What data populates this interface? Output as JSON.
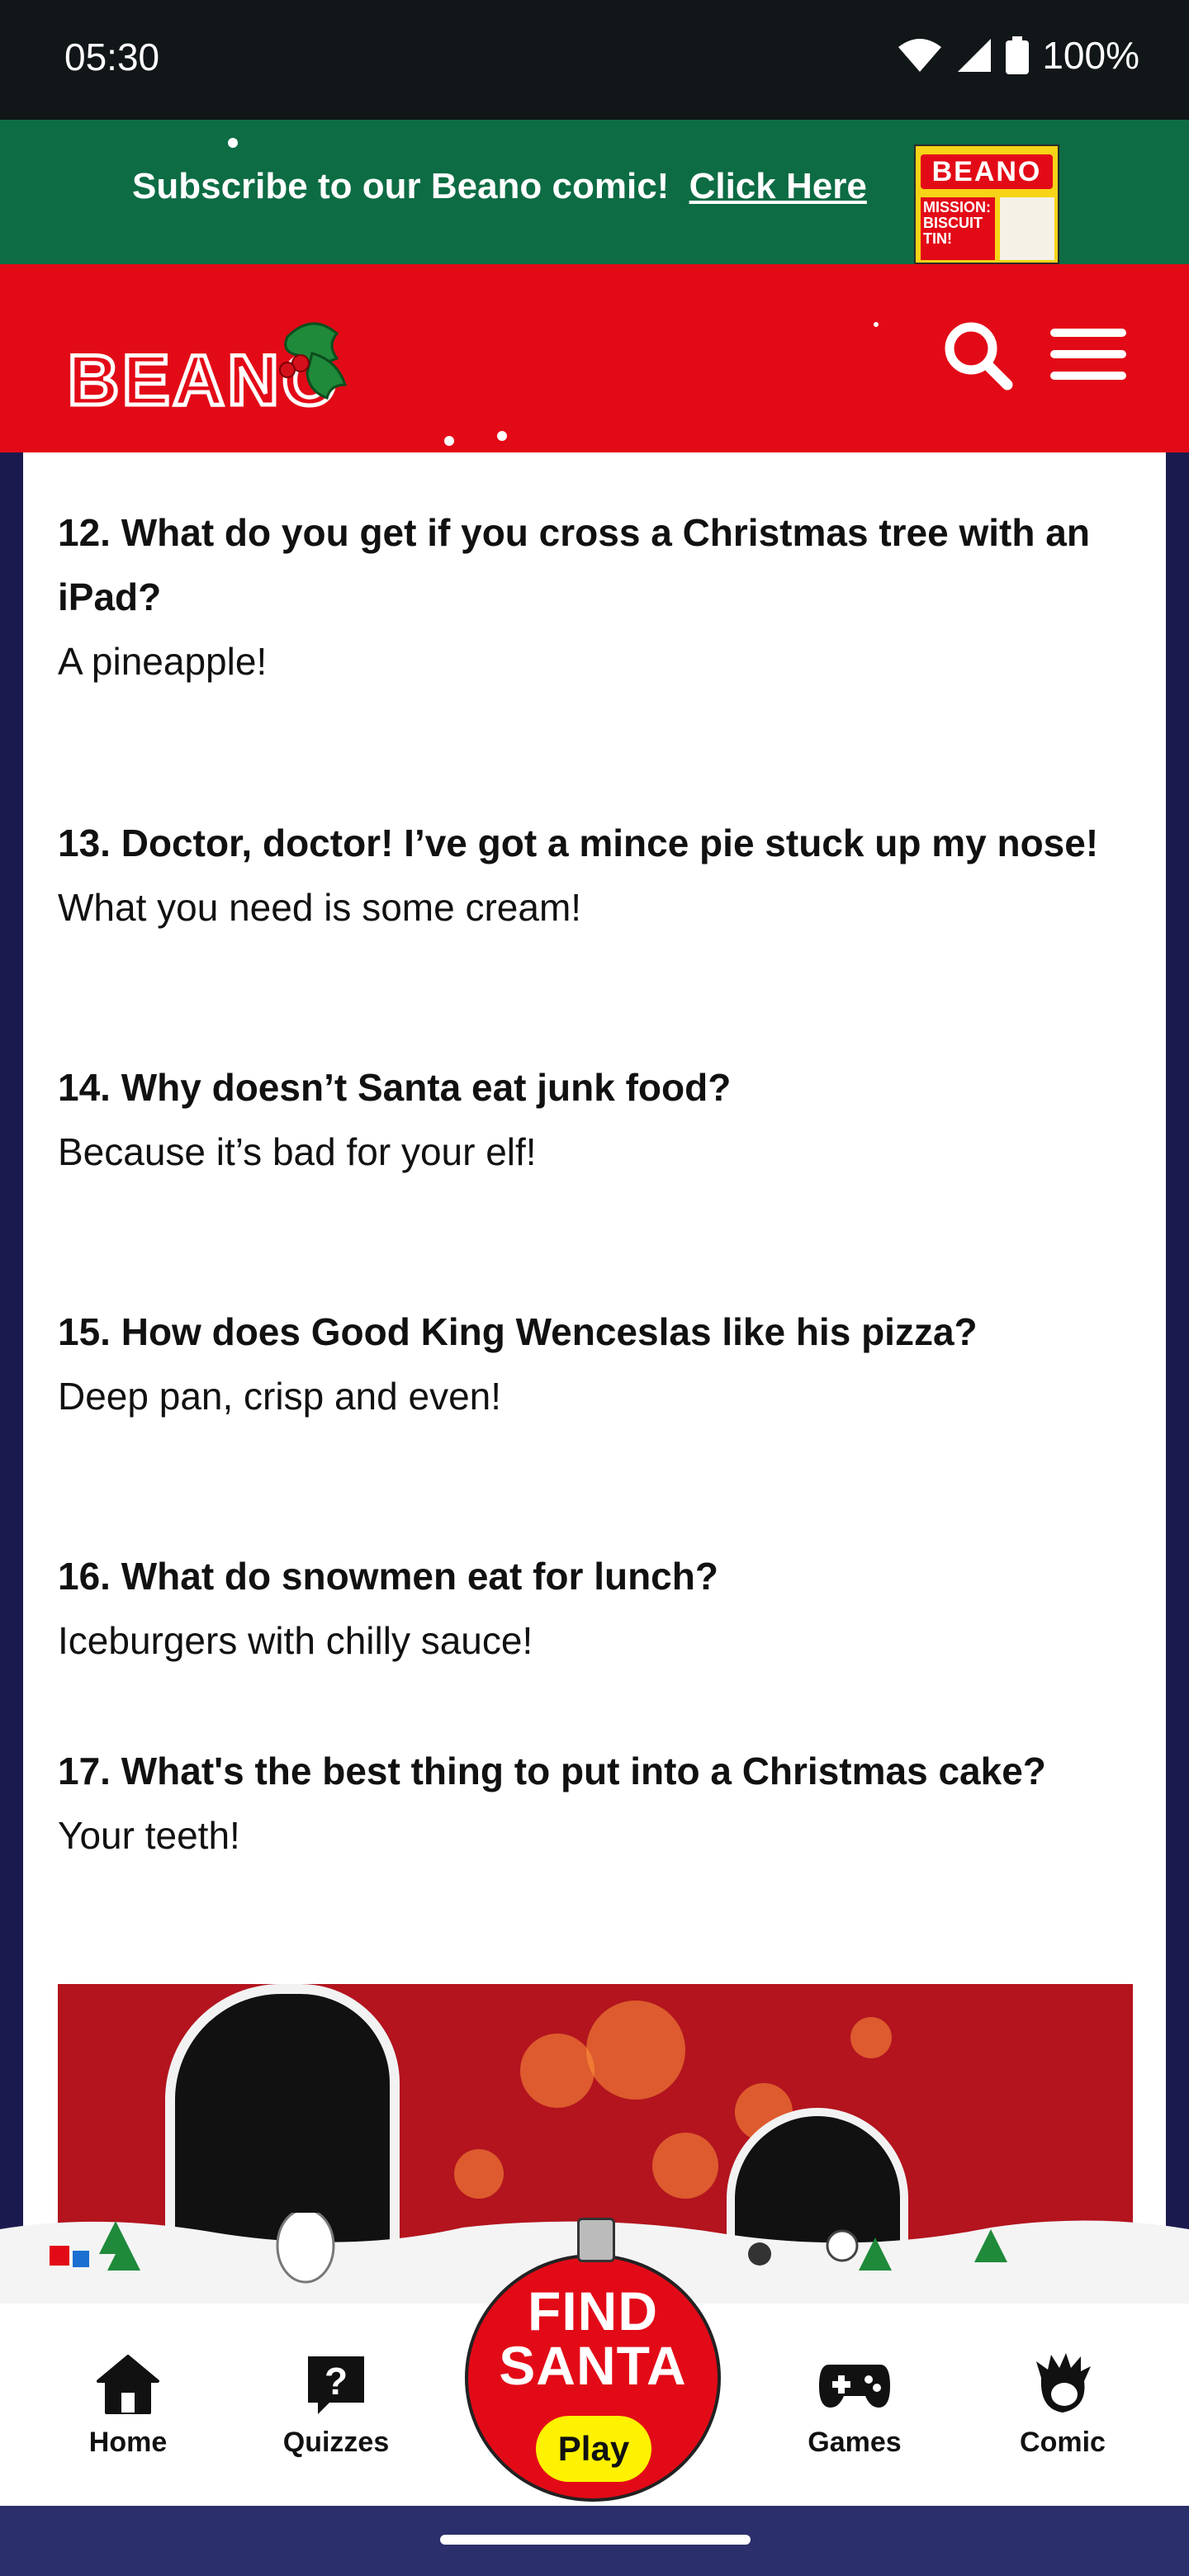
{
  "status": {
    "time": "05:30",
    "battery": "100%"
  },
  "banner": {
    "text": "Subscribe to our Beano comic!",
    "link": "Click Here",
    "mag_logo": "BEANO",
    "mag_headline": "MISSION: BISCUIT TIN!"
  },
  "header": {
    "logo": "BEANO"
  },
  "jokes": [
    {
      "q": "12. What do you get if you cross a Christmas tree with an iPad?",
      "a": "A pineapple!"
    },
    {
      "q": "13. Doctor, doctor! I’ve got a mince pie stuck up my nose!",
      "a": "What you need is some cream!"
    },
    {
      "q": "14. Why doesn’t Santa eat junk food?",
      "a": "Because it’s bad for your elf!"
    },
    {
      "q": "15. How does Good King Wenceslas like his pizza?",
      "a": "Deep pan, crisp and even!"
    },
    {
      "q": "16. What do snowmen eat for lunch?",
      "a": "Iceburgers with chilly sauce!"
    },
    {
      "q": "17. What's the best thing to put into a Christmas cake?",
      "a": "Your teeth!"
    }
  ],
  "nav": {
    "home": "Home",
    "quizzes": "Quizzes",
    "find_santa": "FIND SANTA",
    "play": "Play",
    "games": "Games",
    "comic": "Comic"
  },
  "colors": {
    "brand_red": "#e30a17",
    "banner_green": "#0d6c44",
    "page_bg": "#1b1a4e"
  }
}
